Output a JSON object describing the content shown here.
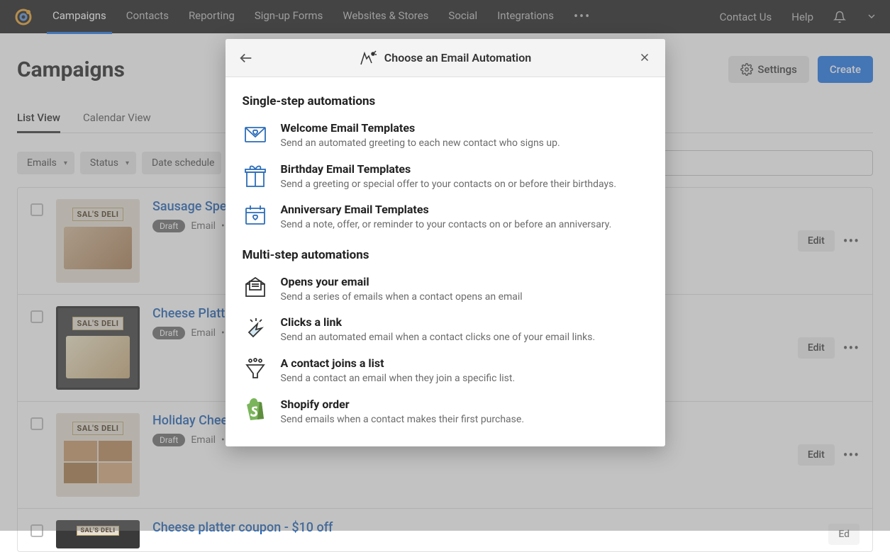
{
  "nav": {
    "items": [
      "Campaigns",
      "Contacts",
      "Reporting",
      "Sign-up Forms",
      "Websites & Stores",
      "Social",
      "Integrations"
    ],
    "contact": "Contact Us",
    "help": "Help"
  },
  "page": {
    "title": "Campaigns",
    "settings_label": "Settings",
    "create_label": "Create"
  },
  "tabs": {
    "list": "List View",
    "calendar": "Calendar View"
  },
  "filters": {
    "emails": "Emails",
    "status": "Status",
    "date": "Date schedule"
  },
  "campaigns": [
    {
      "title": "Sausage Spec",
      "status": "Draft",
      "type": "Email",
      "edit": "Edit",
      "brand": "SAL'S DELI"
    },
    {
      "title": "Cheese Platt",
      "status": "Draft",
      "type": "Email",
      "edit": "Edit",
      "brand": "SAL'S DELI"
    },
    {
      "title": "Holiday Chees",
      "status": "Draft",
      "type": "Email",
      "edit": "Edit",
      "brand": "SAL'S DELI"
    },
    {
      "title": "Cheese platter coupon - $10 off",
      "status": "",
      "type": "",
      "edit": "",
      "brand": "SAL'S DELI"
    }
  ],
  "modal": {
    "title": "Choose an Email Automation",
    "section_single": "Single-step automations",
    "section_multi": "Multi-step automations",
    "single_options": [
      {
        "title": "Welcome Email Templates",
        "desc": "Send an automated greeting to each new contact who signs up."
      },
      {
        "title": "Birthday Email Templates",
        "desc": "Send a greeting or special offer to your contacts on or before their birthdays."
      },
      {
        "title": "Anniversary Email Templates",
        "desc": "Send a note, offer, or reminder to your contacts on or before an anniversary."
      }
    ],
    "multi_options": [
      {
        "title": "Opens your email",
        "desc": "Send a series of emails when a contact opens an email"
      },
      {
        "title": "Clicks a link",
        "desc": "Send an automated email when a contact clicks one of your email links."
      },
      {
        "title": "A contact joins a list",
        "desc": "Send a contact an email when they join a specific list."
      },
      {
        "title": "Shopify order",
        "desc": "Send emails when a contact makes their first purchase."
      }
    ]
  }
}
